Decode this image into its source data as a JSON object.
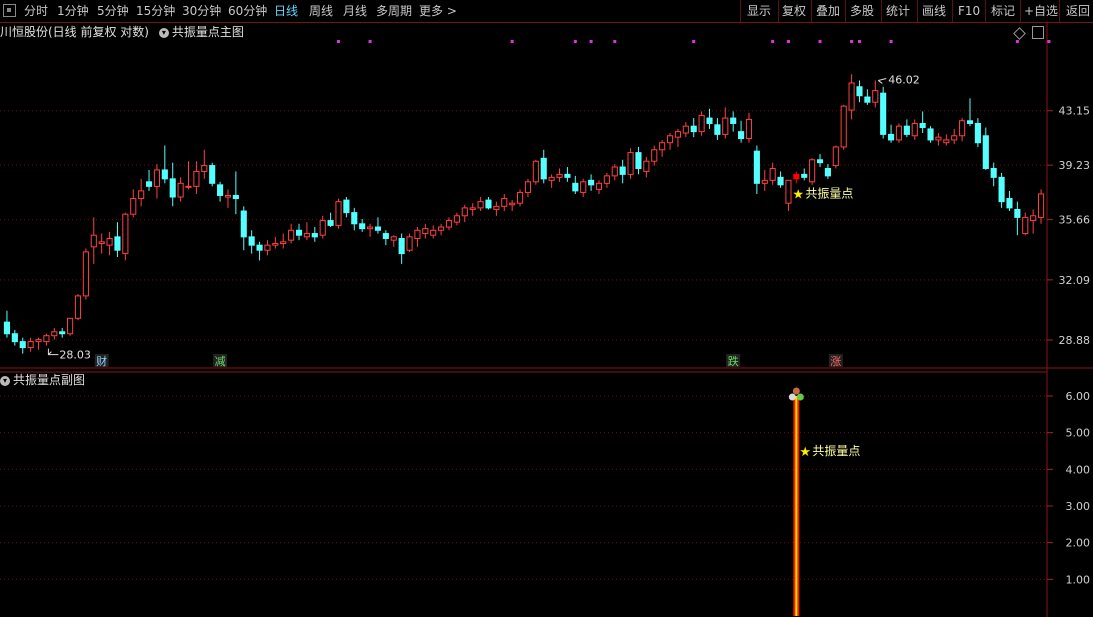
{
  "toolbar": {
    "left_items": [
      "分时",
      "1分钟",
      "5分钟",
      "15分钟",
      "30分钟",
      "60分钟",
      "日线",
      "周线",
      "月线",
      "多周期",
      "更多"
    ],
    "active": "日线",
    "right_items": [
      "显示",
      "复权",
      "叠加",
      "多股",
      "统计",
      "画线",
      "F10",
      "标记",
      "+自选",
      "返回"
    ]
  },
  "main_panel": {
    "title": "川恒股份(日线 前复权 对数)",
    "indicator": "共振量点主图",
    "max_label": "46.02",
    "min_label": "28.03",
    "signal_label": "共振量点",
    "event_markers": [
      "财",
      "减",
      "跌",
      "涨"
    ],
    "event_colors": [
      "#8fd0ff",
      "#66dd66",
      "#66dd66",
      "#ff6666"
    ],
    "y_ticks": [
      "43.15",
      "39.23",
      "35.66",
      "32.09",
      "28.88"
    ]
  },
  "sub_panel": {
    "title": "共振量点副图",
    "signal_label": "共振量点",
    "y_ticks": [
      "6.00",
      "5.00",
      "4.00",
      "3.00",
      "2.00",
      "1.00"
    ]
  },
  "chart_data": {
    "type": "candlestick",
    "scale": "log",
    "ylim": [
      27.5,
      48.5
    ],
    "colors": {
      "up": "#ff4040",
      "down": "#54ffff",
      "signal": "#ff0000",
      "dots": "#dd33dd"
    },
    "candles": [
      [
        29.8,
        30.4,
        29.0,
        29.2
      ],
      [
        29.2,
        29.4,
        28.6,
        28.8
      ],
      [
        28.8,
        29.0,
        28.2,
        28.5
      ],
      [
        28.5,
        29.0,
        28.3,
        28.8
      ],
      [
        28.8,
        29.0,
        28.4,
        28.9
      ],
      [
        28.8,
        29.2,
        28.6,
        29.1
      ],
      [
        29.1,
        29.5,
        28.9,
        29.3
      ],
      [
        29.3,
        29.5,
        29.0,
        29.2
      ],
      [
        29.2,
        30.0,
        29.1,
        30.0
      ],
      [
        30.0,
        31.3,
        29.9,
        31.2
      ],
      [
        31.2,
        33.9,
        31.0,
        33.7
      ],
      [
        34.0,
        35.8,
        33.0,
        34.7
      ],
      [
        34.2,
        34.8,
        33.6,
        34.3
      ],
      [
        34.1,
        34.9,
        33.5,
        34.5
      ],
      [
        34.6,
        35.5,
        33.4,
        33.8
      ],
      [
        33.6,
        36.1,
        33.2,
        36.0
      ],
      [
        36.0,
        37.6,
        35.8,
        37.0
      ],
      [
        37.0,
        38.3,
        36.5,
        37.5
      ],
      [
        38.1,
        38.9,
        37.5,
        37.8
      ],
      [
        37.8,
        39.3,
        37.0,
        38.9
      ],
      [
        38.9,
        40.6,
        38.0,
        38.3
      ],
      [
        38.3,
        39.4,
        36.5,
        37.1
      ],
      [
        37.1,
        38.4,
        36.8,
        38.0
      ],
      [
        37.8,
        39.5,
        37.6,
        37.8
      ],
      [
        37.8,
        39.5,
        37.3,
        38.8
      ],
      [
        38.8,
        40.3,
        38.3,
        39.2
      ],
      [
        39.2,
        39.4,
        37.8,
        38.0
      ],
      [
        37.9,
        38.1,
        36.8,
        37.2
      ],
      [
        37.1,
        37.6,
        36.4,
        37.2
      ],
      [
        37.2,
        38.8,
        36.0,
        37.0
      ],
      [
        36.2,
        36.5,
        33.8,
        34.6
      ],
      [
        34.6,
        35.0,
        33.6,
        34.1
      ],
      [
        34.1,
        34.3,
        33.2,
        33.8
      ],
      [
        33.8,
        34.4,
        33.5,
        34.1
      ],
      [
        34.1,
        34.6,
        33.9,
        34.2
      ],
      [
        34.2,
        34.8,
        33.9,
        34.3
      ],
      [
        34.4,
        35.4,
        34.2,
        35.0
      ],
      [
        35.0,
        35.4,
        34.4,
        34.7
      ],
      [
        34.6,
        35.5,
        34.4,
        34.8
      ],
      [
        34.8,
        35.2,
        34.3,
        34.6
      ],
      [
        34.7,
        35.9,
        34.5,
        35.6
      ],
      [
        35.6,
        36.1,
        35.2,
        35.3
      ],
      [
        35.3,
        37.0,
        35.1,
        36.8
      ],
      [
        36.9,
        37.1,
        35.8,
        36.1
      ],
      [
        36.1,
        36.4,
        35.0,
        35.4
      ],
      [
        35.4,
        35.7,
        34.9,
        35.1
      ],
      [
        35.1,
        35.4,
        34.6,
        35.2
      ],
      [
        35.2,
        35.8,
        34.8,
        35.0
      ],
      [
        34.8,
        35.0,
        34.1,
        34.5
      ],
      [
        34.4,
        34.7,
        34.0,
        34.6
      ],
      [
        34.5,
        34.8,
        33.0,
        33.6
      ],
      [
        33.8,
        34.8,
        33.7,
        34.6
      ],
      [
        34.5,
        35.2,
        34.0,
        35.0
      ],
      [
        34.8,
        35.4,
        34.5,
        35.1
      ],
      [
        34.7,
        35.3,
        34.5,
        35.0
      ],
      [
        35.0,
        35.4,
        34.7,
        35.2
      ],
      [
        35.2,
        35.8,
        35.0,
        35.6
      ],
      [
        35.5,
        36.1,
        35.3,
        35.9
      ],
      [
        35.9,
        36.6,
        35.5,
        36.4
      ],
      [
        36.3,
        36.7,
        35.9,
        36.4
      ],
      [
        36.4,
        37.1,
        36.2,
        36.8
      ],
      [
        36.9,
        37.1,
        36.3,
        36.4
      ],
      [
        36.3,
        36.8,
        35.9,
        36.5
      ],
      [
        36.5,
        37.3,
        36.2,
        37.0
      ],
      [
        36.6,
        36.9,
        36.2,
        36.7
      ],
      [
        36.7,
        37.6,
        36.5,
        37.4
      ],
      [
        37.4,
        38.3,
        37.1,
        38.1
      ],
      [
        38.1,
        39.6,
        37.9,
        39.5
      ],
      [
        39.7,
        40.3,
        38.0,
        38.3
      ],
      [
        38.2,
        38.6,
        37.7,
        38.4
      ],
      [
        38.4,
        39.0,
        38.1,
        38.6
      ],
      [
        38.6,
        39.1,
        38.1,
        38.4
      ],
      [
        38.0,
        38.5,
        37.3,
        37.5
      ],
      [
        37.4,
        38.3,
        37.1,
        38.1
      ],
      [
        38.2,
        38.6,
        37.5,
        37.9
      ],
      [
        37.6,
        38.2,
        37.3,
        38.0
      ],
      [
        38.0,
        38.7,
        37.7,
        38.5
      ],
      [
        38.5,
        39.3,
        38.2,
        39.1
      ],
      [
        39.1,
        39.6,
        38.0,
        38.6
      ],
      [
        38.6,
        40.4,
        38.3,
        40.1
      ],
      [
        40.1,
        40.5,
        38.6,
        39.0
      ],
      [
        38.8,
        39.8,
        38.4,
        39.5
      ],
      [
        39.5,
        40.6,
        39.2,
        40.3
      ],
      [
        40.3,
        41.0,
        39.8,
        40.8
      ],
      [
        40.8,
        41.5,
        40.3,
        41.3
      ],
      [
        41.2,
        41.8,
        40.5,
        41.6
      ],
      [
        41.5,
        42.3,
        41.2,
        42.0
      ],
      [
        42.0,
        42.6,
        41.2,
        41.6
      ],
      [
        41.6,
        43.1,
        41.3,
        42.8
      ],
      [
        42.6,
        43.3,
        41.8,
        42.2
      ],
      [
        42.1,
        42.6,
        41.0,
        41.4
      ],
      [
        41.4,
        43.4,
        41.1,
        42.6
      ],
      [
        42.6,
        43.1,
        41.6,
        42.2
      ],
      [
        41.6,
        42.4,
        40.8,
        41.1
      ],
      [
        41.1,
        43.0,
        40.8,
        42.5
      ],
      [
        40.2,
        40.6,
        37.3,
        38.0
      ],
      [
        38.0,
        38.9,
        37.5,
        38.2
      ],
      [
        38.2,
        39.4,
        37.9,
        39.0
      ],
      [
        38.4,
        38.8,
        37.7,
        37.9
      ],
      [
        36.7,
        38.2,
        36.2,
        38.2
      ],
      [
        38.3,
        38.8,
        38.0,
        38.6
      ],
      [
        38.6,
        39.0,
        38.2,
        38.4
      ],
      [
        38.1,
        39.7,
        37.9,
        39.6
      ],
      [
        39.6,
        40.0,
        39.1,
        39.4
      ],
      [
        39.0,
        39.3,
        38.3,
        38.5
      ],
      [
        39.2,
        40.6,
        39.0,
        40.5
      ],
      [
        40.5,
        43.6,
        40.3,
        43.5
      ],
      [
        43.2,
        46.0,
        42.5,
        45.3
      ],
      [
        45.0,
        45.5,
        43.8,
        44.3
      ],
      [
        44.2,
        44.8,
        43.6,
        43.8
      ],
      [
        43.8,
        45.5,
        43.4,
        44.7
      ],
      [
        44.5,
        45.0,
        41.1,
        41.4
      ],
      [
        41.4,
        42.1,
        40.8,
        41.0
      ],
      [
        41.0,
        42.2,
        40.8,
        42.0
      ],
      [
        42.0,
        42.5,
        41.2,
        41.4
      ],
      [
        41.3,
        42.5,
        41.0,
        42.2
      ],
      [
        42.2,
        43.1,
        41.5,
        41.9
      ],
      [
        41.8,
        42.0,
        40.8,
        41.0
      ],
      [
        41.0,
        41.5,
        40.6,
        41.2
      ],
      [
        40.8,
        41.4,
        40.6,
        41.0
      ],
      [
        41.0,
        41.8,
        40.7,
        41.3
      ],
      [
        41.3,
        42.6,
        40.9,
        42.4
      ],
      [
        42.4,
        44.1,
        42.0,
        42.2
      ],
      [
        42.2,
        42.6,
        40.5,
        40.8
      ],
      [
        41.3,
        41.9,
        38.9,
        39.0
      ],
      [
        39.0,
        39.4,
        37.8,
        38.4
      ],
      [
        38.4,
        38.7,
        36.4,
        36.8
      ],
      [
        37.0,
        37.5,
        36.2,
        36.4
      ],
      [
        36.3,
        36.8,
        34.7,
        35.8
      ],
      [
        34.8,
        36.1,
        34.7,
        35.8
      ],
      [
        35.6,
        36.3,
        34.8,
        35.9
      ],
      [
        35.8,
        37.6,
        35.4,
        37.3
      ]
    ],
    "signal_index": 100,
    "max_index": 110,
    "min_index": 5,
    "event_indices": [
      12,
      27,
      92,
      105
    ],
    "dot_indices": [
      42,
      46,
      64,
      72,
      74,
      77,
      87,
      97,
      99,
      103,
      107,
      108,
      112,
      128,
      132,
      141
    ],
    "sub": {
      "ylim": [
        0,
        6.6
      ],
      "signal_value": 6.0
    }
  }
}
